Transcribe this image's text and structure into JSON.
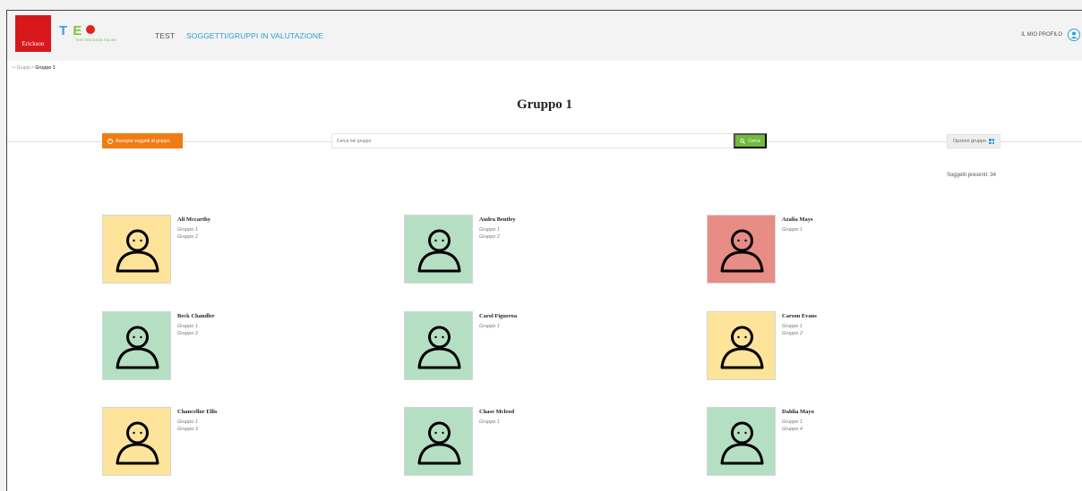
{
  "header": {
    "logo_text": "Erickson",
    "app_subtitle": "TEST ERICKSON ONLINE",
    "nav": [
      "TEST",
      "SOGGETTI/GRUPPI IN VALUTAZIONE"
    ],
    "profile_label": "IL MIO PROFILO"
  },
  "breadcrumb": {
    "root": "Gruppi",
    "current": "Gruppo 1"
  },
  "page_title": "Gruppo 1",
  "toolbar": {
    "assign_label": "Assegna soggetti al gruppo",
    "search_placeholder": "Cerca nel gruppo",
    "search_button": "Cerca",
    "options_label": "Opzioni gruppo"
  },
  "subjects_count": "Soggetti presenti: 34",
  "colors": {
    "yellow": "#fde49a",
    "green": "#b5dfc3",
    "red": "#e78d85",
    "orange": "#f07c14",
    "accent": "#2b9ed6"
  },
  "subjects": [
    {
      "name": "Ali Mccarthy",
      "groups": [
        "Gruppo 1",
        "Gruppo 2"
      ],
      "color": "yellow"
    },
    {
      "name": "Audra Bentley",
      "groups": [
        "Gruppo 1",
        "Gruppo 2"
      ],
      "color": "green"
    },
    {
      "name": "Azalia Mays",
      "groups": [
        "Gruppo 1"
      ],
      "color": "red"
    },
    {
      "name": "Beck Chandler",
      "groups": [
        "Gruppo 1",
        "Gruppo 2"
      ],
      "color": "green"
    },
    {
      "name": "Carol Figueroa",
      "groups": [
        "Gruppo 1"
      ],
      "color": "green"
    },
    {
      "name": "Carson Evans",
      "groups": [
        "Gruppo 1",
        "Gruppo 2"
      ],
      "color": "yellow"
    },
    {
      "name": "Chancellor Ellis",
      "groups": [
        "Gruppo 1",
        "Gruppo 3"
      ],
      "color": "yellow"
    },
    {
      "name": "Chase Mcleod",
      "groups": [
        "Gruppo 1"
      ],
      "color": "green"
    },
    {
      "name": "Dahlia Mayo",
      "groups": [
        "Gruppo 1",
        "Gruppo 4"
      ],
      "color": "green"
    }
  ]
}
